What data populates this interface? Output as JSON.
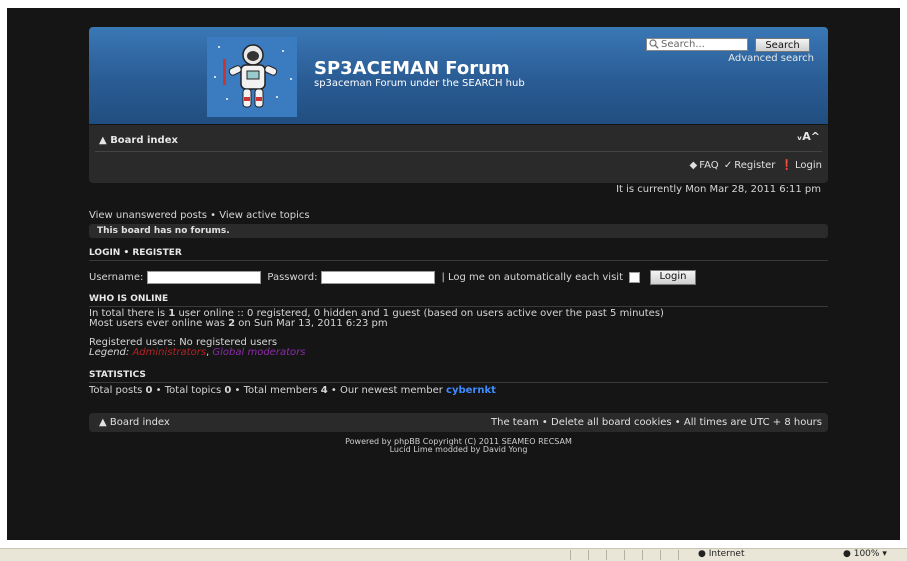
{
  "header": {
    "title": "SP3ACEMAN Forum",
    "description": "sp3aceman Forum under the SEARCH hub",
    "search_placeholder": "Search...",
    "search_button": "Search",
    "advanced_search": "Advanced search",
    "logo_icon": "astronaut-logo"
  },
  "navbar": {
    "board_index": "Board index",
    "font_size_control": "ᵥA^",
    "faq": "FAQ",
    "register": "Register",
    "login": "Login"
  },
  "current_time": "It is currently Mon Mar 28, 2011 6:11 pm",
  "quick_links": "View unanswered posts • View active topics",
  "no_forums": "This board has no forums.",
  "login_section": {
    "heading": "LOGIN • REGISTER",
    "username_label": "Username:",
    "password_label": "Password:",
    "autologin_label": "| Log me on automatically each visit",
    "login_button": "Login"
  },
  "who_is_online": {
    "heading": "WHO IS ONLINE",
    "line1_prefix": "In total there is ",
    "line1_count": "1",
    "line1_suffix": " user online :: 0 registered, 0 hidden and 1 guest (based on users active over the past 5 minutes)",
    "line2_prefix": "Most users ever online was ",
    "line2_count": "2",
    "line2_suffix": " on Sun Mar 13, 2011 6:23 pm",
    "registered_users": "Registered users: No registered users",
    "legend_label": "Legend:",
    "legend_admins": "Administrators",
    "legend_sep": ", ",
    "legend_gmods": "Global moderators"
  },
  "statistics": {
    "heading": "STATISTICS",
    "posts_label": "Total posts ",
    "posts": "0",
    "topics_label": " • Total topics ",
    "topics": "0",
    "members_label": " • Total members ",
    "members": "4",
    "newest_label": " • Our newest member ",
    "newest_member": "cybernkt"
  },
  "footer": {
    "board_index": "Board index",
    "right_links": "The team • Delete all board cookies • All times are UTC + 8 hours",
    "credit1": "Powered by phpBB Copyright (C) 2011 SEAMEO RECSAM",
    "credit2": "Lucid Lime modded by David Yong"
  },
  "statusbar": {
    "zone": "Internet",
    "zoom": "100%"
  },
  "colors": {
    "header_blue": "#2a5c94",
    "admin_red": "#b22222",
    "gmod_purple": "#8a2ba6",
    "member_blue": "#3f8bff"
  }
}
